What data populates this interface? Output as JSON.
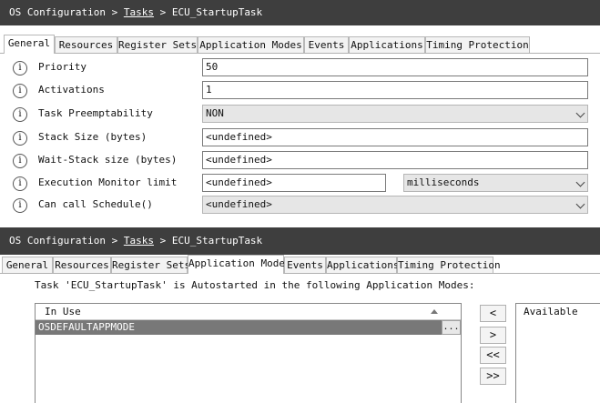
{
  "top": {
    "breadcrumb": {
      "root": "OS Configuration",
      "sep1": ">",
      "tasks": "Tasks",
      "sep2": ">",
      "current": "ECU_StartupTask"
    },
    "tabs": [
      "General",
      "Resources",
      "Register Sets",
      "Application Modes",
      "Events",
      "Applications",
      "Timing Protection"
    ],
    "active_tab": "General",
    "fields": [
      {
        "label": "Priority",
        "value": "50"
      },
      {
        "label": "Activations",
        "value": "1"
      },
      {
        "label": "Task Preemptability",
        "value": "NON"
      },
      {
        "label": "Stack Size (bytes)",
        "value": "<undefined>"
      },
      {
        "label": "Wait-Stack size (bytes)",
        "value": "<undefined>"
      },
      {
        "label": "Execution Monitor limit",
        "value": "<undefined>",
        "unit": "milliseconds"
      },
      {
        "label": "Can call Schedule()",
        "value": "<undefined>"
      }
    ],
    "info_glyph": "i"
  },
  "bottom": {
    "breadcrumb": {
      "root": "OS Configuration",
      "sep1": ">",
      "tasks": "Tasks",
      "sep2": ">",
      "current": "ECU_StartupTask"
    },
    "tabs": [
      "General",
      "Resources",
      "Register Sets",
      "Application Modes",
      "Events",
      "Applications",
      "Timing Protection"
    ],
    "active_tab": "Application Modes",
    "description": "Task 'ECU_StartupTask' is Autostarted in the following Application Modes:",
    "in_use_header": "In Use",
    "in_use_items": [
      "OSDEFAULTAPPMODE"
    ],
    "ellipsis": "...",
    "available_header": "Available",
    "move_buttons": [
      "<",
      ">",
      "<<",
      ">>"
    ]
  },
  "colors": {
    "header_bg": "#3e3e3e",
    "selected_row": "#787878",
    "field_border": "#7a7a7a"
  },
  "icons": {
    "info": "info-circle-icon",
    "dropdown": "chevron-down-icon",
    "sort": "sort-ascending-icon"
  }
}
